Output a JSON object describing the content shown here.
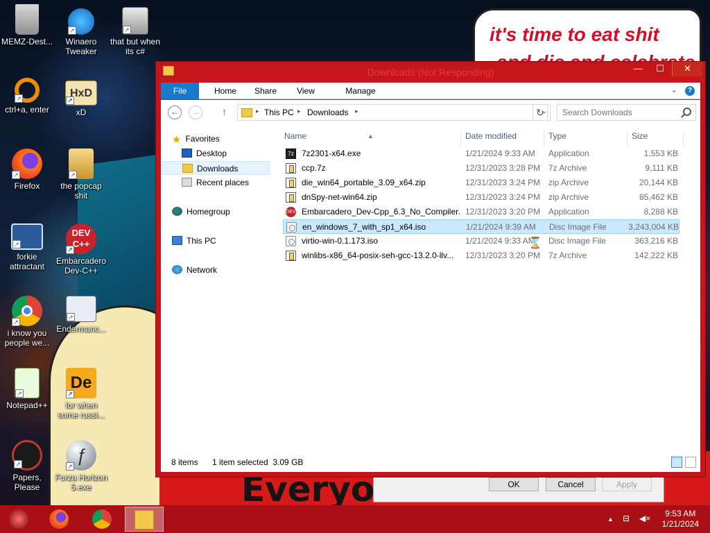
{
  "wallpaper": {
    "bubble_line1": "it's time to eat shit",
    "bubble_line2": "and die and celebrate",
    "poster_text": "Everyo"
  },
  "desktop_icons": [
    {
      "id": "memz",
      "label": "MEMZ-Dest...",
      "icon": "recycle-bin-icon"
    },
    {
      "id": "winaero",
      "label": "Winaero Tweaker",
      "icon": "winaero-icon"
    },
    {
      "id": "thatbut",
      "label": "that but when its c#",
      "icon": "windows-stack-icon"
    },
    {
      "id": "ctrla",
      "label": "ctrl+a, enter",
      "icon": "ring-icon"
    },
    {
      "id": "xd",
      "label": "xD",
      "icon": "hxd-icon"
    },
    {
      "id": "firefox",
      "label": "Firefox",
      "icon": "firefox-icon"
    },
    {
      "id": "popcap",
      "label": "the popcap shit",
      "icon": "popcap-icon"
    },
    {
      "id": "forkie",
      "label": "forkie attractant",
      "icon": "gear-monitor-icon"
    },
    {
      "id": "embarcadero",
      "label": "Embarcadero Dev-C++",
      "icon": "devcpp-icon"
    },
    {
      "id": "chrome",
      "label": "i know you people we...",
      "icon": "chrome-icon"
    },
    {
      "id": "enderman",
      "label": "Endermanc...",
      "icon": "window-app-icon"
    },
    {
      "id": "notepadpp",
      "label": "Notepad++",
      "icon": "notepad-plus-plus-icon"
    },
    {
      "id": "forwhen",
      "label": "for when some russi...",
      "icon": "de-icon"
    },
    {
      "id": "papers",
      "label": "Papers, Please",
      "icon": "papers-please-icon"
    },
    {
      "id": "forza",
      "label": "Forza Horizon 5.exe",
      "icon": "flash-icon"
    }
  ],
  "back_dialog": {
    "ok": "OK",
    "cancel": "Cancel",
    "apply": "Apply"
  },
  "window": {
    "title": "Downloads (Not Responding)",
    "min_glyph": "—",
    "max_glyph": "☐",
    "close_glyph": "✕",
    "ribbon_tabs": [
      "File",
      "Home",
      "Share",
      "View",
      "Manage"
    ],
    "ribbon_expand": "⌄",
    "help": "?",
    "back_glyph": "←",
    "forward_glyph": "→",
    "up_glyph": "↑",
    "crumb_sep": "▸",
    "dropdown_glyph": "⌄",
    "refresh_glyph": "↻",
    "address": [
      "This PC",
      "Downloads"
    ],
    "search_placeholder": "Search Downloads",
    "nav": {
      "favorites": "Favorites",
      "desktop": "Desktop",
      "downloads": "Downloads",
      "recent": "Recent places",
      "homegroup": "Homegroup",
      "thispc": "This PC",
      "network": "Network"
    },
    "columns": {
      "name": "Name",
      "date": "Date modified",
      "type": "Type",
      "size": "Size",
      "sort_glyph": "▲"
    },
    "files": [
      {
        "name": "7z2301-x64.exe",
        "date": "1/21/2024 9:33 AM",
        "type": "Application",
        "size": "1,553 KB",
        "icon": "7zip-exe-icon"
      },
      {
        "name": "ccp.7z",
        "date": "12/31/2023 3:28 PM",
        "type": "7z Archive",
        "size": "9,111 KB",
        "icon": "archive-icon"
      },
      {
        "name": "die_win64_portable_3.09_x64.zip",
        "date": "12/31/2023 3:24 PM",
        "type": "zip Archive",
        "size": "20,144 KB",
        "icon": "archive-icon"
      },
      {
        "name": "dnSpy-net-win64.zip",
        "date": "12/31/2023 3:24 PM",
        "type": "zip Archive",
        "size": "85,462 KB",
        "icon": "archive-icon"
      },
      {
        "name": "Embarcadero_Dev-Cpp_6.3_No_Compiler...",
        "date": "12/31/2023 3:20 PM",
        "type": "Application",
        "size": "8,288 KB",
        "icon": "devcpp-icon"
      },
      {
        "name": "en_windows_7_with_sp1_x64.iso",
        "date": "1/21/2024 9:39 AM",
        "type": "Disc Image File",
        "size": "3,243,004 KB",
        "icon": "disc-image-icon"
      },
      {
        "name": "virtio-win-0.1.173.iso",
        "date": "1/21/2024 9:33 AM",
        "type": "Disc Image File",
        "size": "363,216 KB",
        "icon": "disc-image-icon"
      },
      {
        "name": "winlibs-x86_64-posix-seh-gcc-13.2.0-llv...",
        "date": "12/31/2023 3:20 PM",
        "type": "7z Archive",
        "size": "142,222 KB",
        "icon": "archive-icon"
      }
    ],
    "selected_index": 5,
    "status": {
      "count": "8 items",
      "selection": "1 item selected  3.09 GB"
    }
  },
  "taskbar": {
    "items": [
      "start-orb-icon",
      "firefox-icon",
      "chrome-icon",
      "file-explorer-icon"
    ],
    "tray_chevron": "▲",
    "network_glyph": "⊟",
    "volume_glyph": "◀×",
    "time": "9:53 AM",
    "date": "1/21/2024"
  },
  "colors": {
    "window_frame": "#c4161c",
    "accent": "#1979ca",
    "selection": "#cce8ff",
    "taskbar": "#a90f15"
  }
}
